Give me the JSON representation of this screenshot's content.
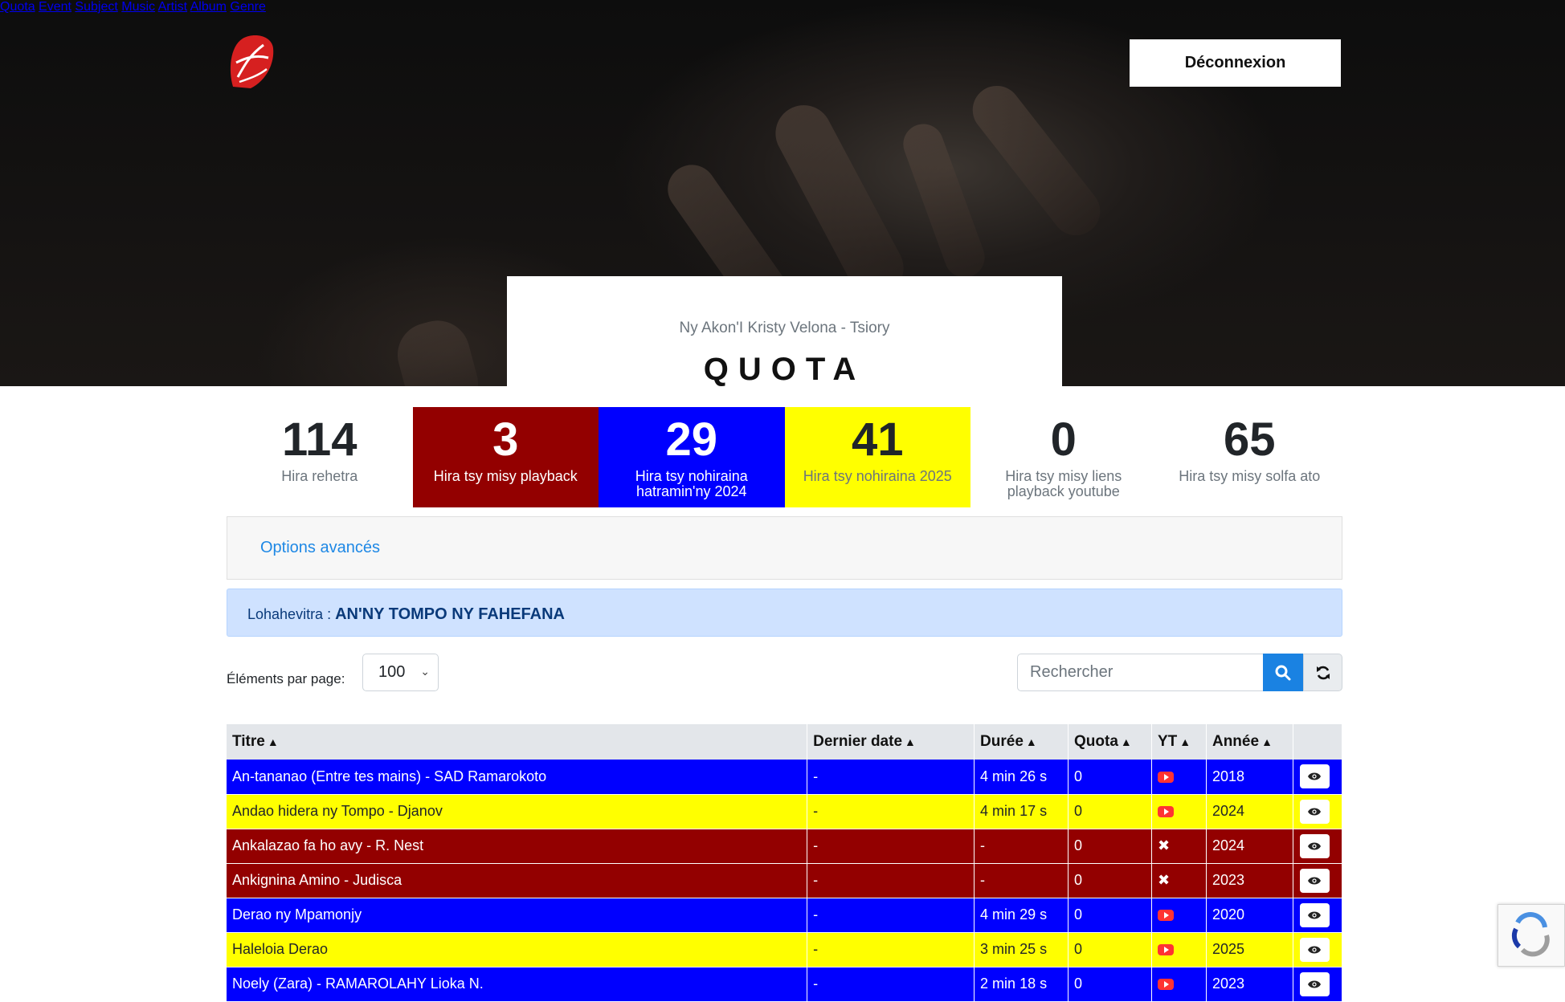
{
  "nav": {
    "logo_text": "Ny Akon'I Kristy Velona",
    "items": [
      {
        "label": "Quota"
      },
      {
        "label": "Event"
      },
      {
        "label": "Subject"
      },
      {
        "label": "Music"
      },
      {
        "label": "Artist"
      },
      {
        "label": "Album"
      },
      {
        "label": "Genre"
      }
    ],
    "logout_label": "Déconnexion"
  },
  "header": {
    "subtitle": "Ny Akon'I Kristy Velona - Tsiory",
    "title": "QUOTA"
  },
  "stats": [
    {
      "value": "114",
      "label": "Hira rehetra",
      "bg": "#ffffff",
      "color": "#212529",
      "label_color": "#6c757d"
    },
    {
      "value": "3",
      "label": "Hira tsy misy playback",
      "bg": "#930000",
      "color": "#ffffff",
      "label_color": "#ffffff"
    },
    {
      "value": "29",
      "label": "Hira tsy nohiraina hatramin'ny 2024",
      "bg": "#0000ff",
      "color": "#ffffff",
      "label_color": "#ffffff"
    },
    {
      "value": "41",
      "label": "Hira tsy nohiraina 2025",
      "bg": "#ffff00",
      "color": "#212529",
      "label_color": "#6c757d"
    },
    {
      "value": "0",
      "label": "Hira tsy misy liens playback youtube",
      "bg": "#ffffff",
      "color": "#212529",
      "label_color": "#6c757d"
    },
    {
      "value": "65",
      "label": "Hira tsy misy solfa ato",
      "bg": "#ffffff",
      "color": "#212529",
      "label_color": "#6c757d"
    }
  ],
  "options": {
    "label": "Options avancés"
  },
  "subject": {
    "label": "Lohahevitra :",
    "value": "AN'NY TOMPO NY FAHEFANA"
  },
  "controls": {
    "per_page_label": "Éléments par page:",
    "per_page_value": "100",
    "search_placeholder": "Rechercher"
  },
  "table": {
    "headers": [
      "Titre",
      "Dernier date",
      "Durée",
      "Quota",
      "YT",
      "Année",
      ""
    ],
    "rows": [
      {
        "title": "An-tananao (Entre tes mains) - SAD Ramarokoto",
        "last_date": "-",
        "duration": "4 min 26 s",
        "quota": "0",
        "yt": "youtube",
        "year": "2018",
        "color": "blue"
      },
      {
        "title": "Andao hidera ny Tompo - Djanov",
        "last_date": "-",
        "duration": "4 min 17 s",
        "quota": "0",
        "yt": "youtube",
        "year": "2024",
        "color": "yellow"
      },
      {
        "title": "Ankalazao fa ho avy - R. Nest",
        "last_date": "-",
        "duration": "-",
        "quota": "0",
        "yt": "none",
        "year": "2024",
        "color": "red"
      },
      {
        "title": "Ankignina Amino - Judisca",
        "last_date": "-",
        "duration": "-",
        "quota": "0",
        "yt": "none",
        "year": "2023",
        "color": "red"
      },
      {
        "title": "Derao ny Mpamonjy",
        "last_date": "-",
        "duration": "4 min 29 s",
        "quota": "0",
        "yt": "youtube",
        "year": "2020",
        "color": "blue"
      },
      {
        "title": "Haleloia Derao",
        "last_date": "-",
        "duration": "3 min 25 s",
        "quota": "0",
        "yt": "youtube",
        "year": "2025",
        "color": "yellow"
      },
      {
        "title": "Noely (Zara) - RAMAROLAHY Lioka N.",
        "last_date": "-",
        "duration": "2 min 18 s",
        "quota": "0",
        "yt": "youtube",
        "year": "2023",
        "color": "blue"
      }
    ]
  }
}
